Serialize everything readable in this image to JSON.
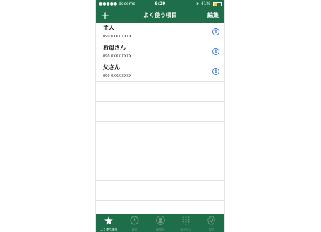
{
  "status": {
    "carrier": "●●●●● docomo",
    "time": "9:29",
    "battery_percent": "41%",
    "battery_level": 0.41
  },
  "nav": {
    "add_label": "+",
    "title": "よく使う項目",
    "edit_label": "編集"
  },
  "favorites": [
    {
      "name": "主人",
      "number": "090 XXXX XXXX"
    },
    {
      "name": "お母さん",
      "number": "090 XXXX XXXX"
    },
    {
      "name": "父さん",
      "number": "090 XXXX XXXX"
    }
  ],
  "tabs": [
    {
      "label": "よく使う項目",
      "icon": "star-icon",
      "active": true
    },
    {
      "label": "履歴",
      "icon": "clock-icon",
      "active": false
    },
    {
      "label": "連絡先",
      "icon": "person-icon",
      "active": false
    },
    {
      "label": "ダイヤル",
      "icon": "keypad-icon",
      "active": false
    },
    {
      "label": "設定",
      "icon": "gear-icon",
      "active": false
    }
  ],
  "colors": {
    "header": "#1f6e4a",
    "info_blue": "#2d7be0"
  }
}
